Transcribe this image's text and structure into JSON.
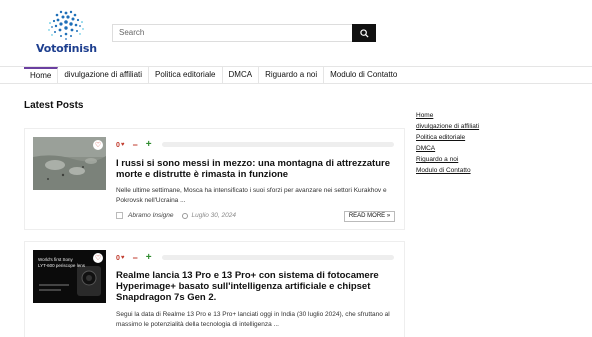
{
  "site": {
    "logo_text": "Votofinish"
  },
  "search": {
    "placeholder": "Search"
  },
  "nav": {
    "items": [
      {
        "label": "Home"
      },
      {
        "label": "divulgazione di affiliati"
      },
      {
        "label": "Politica editoriale"
      },
      {
        "label": "DMCA"
      },
      {
        "label": "Riguardo a noi"
      },
      {
        "label": "Modulo di Contatto"
      }
    ]
  },
  "main": {
    "heading": "Latest Posts",
    "posts": [
      {
        "vote_count": "0",
        "vote_minus": "−",
        "vote_plus": "+",
        "title": "I russi si sono messi in mezzo: una montagna di attrezzature morte e distrutte è rimasta in funzione",
        "excerpt": "Nelle ultime settimane, Mosca ha intensificato i suoi sforzi per avanzare nei settori Kurakhov e Pokrovsk nell'Ucraina ...",
        "author": "Abramo Insigne",
        "date": "Luglio 30, 2024",
        "read_more": "READ MORE »"
      },
      {
        "vote_count": "0",
        "vote_minus": "−",
        "vote_plus": "+",
        "title": "Realme lancia 13 Pro e 13 Pro+ con sistema di fotocamere Hyperimage+ basato sull'intelligenza artificiale e chipset Snapdragon 7s Gen 2.",
        "excerpt": "Segui la data di Realme 13 Pro e 13 Pro+ lanciati oggi in India (30 luglio 2024), che sfruttano al massimo le potenzialità della tecnologia di intelligenza ...",
        "thumb_text_1": "World's first Sony",
        "thumb_text_2": "LYT-600 periscope lens"
      }
    ]
  },
  "sidebar": {
    "links": [
      {
        "label": "Home"
      },
      {
        "label": "divulgazione di affiliati"
      },
      {
        "label": "Politica editoriale"
      },
      {
        "label": "DMCA"
      },
      {
        "label": "Riguardo a noi"
      },
      {
        "label": "Modulo di Contatto"
      }
    ]
  },
  "colors": {
    "accent": "#6b3fa0",
    "brand": "#1e3f8f",
    "vote_red": "#c0392b",
    "vote_green": "#2e8b2e"
  }
}
